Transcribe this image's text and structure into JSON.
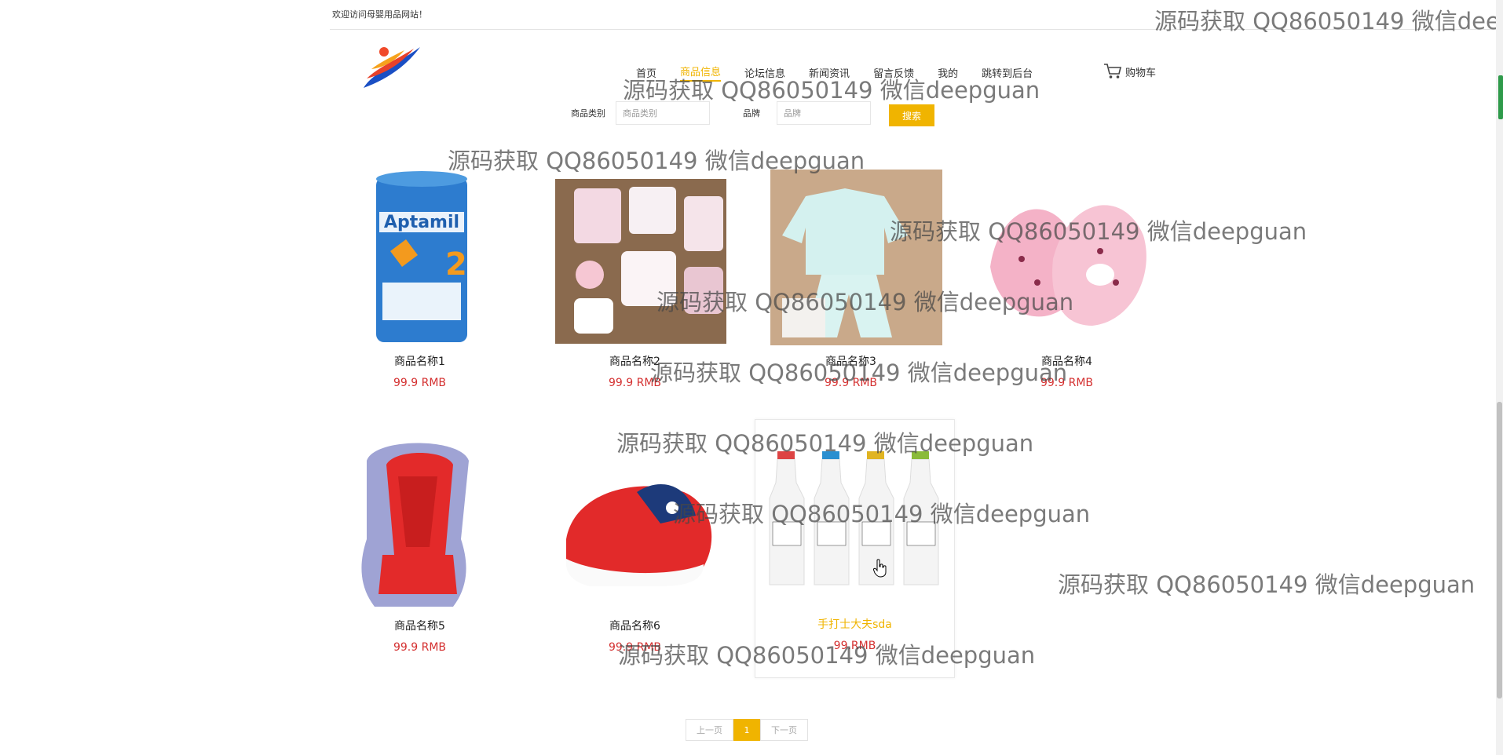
{
  "header": {
    "welcome": "欢迎访问母婴用品网站！"
  },
  "nav": {
    "items": [
      "首页",
      "商品信息",
      "论坛信息",
      "新闻资讯",
      "留言反馈",
      "我的",
      "跳转到后台"
    ],
    "active_index": 1,
    "cart_label": "购物车"
  },
  "search": {
    "category_label": "商品类别",
    "category_placeholder": "商品类别",
    "brand_label": "品牌",
    "brand_placeholder": "品牌",
    "button_label": "搜索"
  },
  "products": [
    {
      "name": "商品名称1",
      "price": "99.9 RMB",
      "image": "milk-formula-can"
    },
    {
      "name": "商品名称2",
      "price": "99.9 RMB",
      "image": "baby-clothes-set"
    },
    {
      "name": "商品名称3",
      "price": "99.9 RMB",
      "image": "baby-pajamas"
    },
    {
      "name": "商品名称4",
      "price": "99.9 RMB",
      "image": "pink-baby-shoes"
    },
    {
      "name": "商品名称5",
      "price": "99.9 RMB",
      "image": "car-seat"
    },
    {
      "name": "商品名称6",
      "price": "99.9 RMB",
      "image": "red-baby-shoes"
    },
    {
      "name": "手打士大夫sda",
      "price": "99.RMB",
      "image": "milk-bottles"
    }
  ],
  "pagination": {
    "prev": "上一页",
    "current": "1",
    "next": "下一页"
  },
  "watermark": "源码获取 QQ86050149 微信deepguan",
  "watermark_clipped": "源码获取 QQ86050149 微信dee",
  "colors": {
    "accent": "#f0b400",
    "price": "#d43030"
  }
}
